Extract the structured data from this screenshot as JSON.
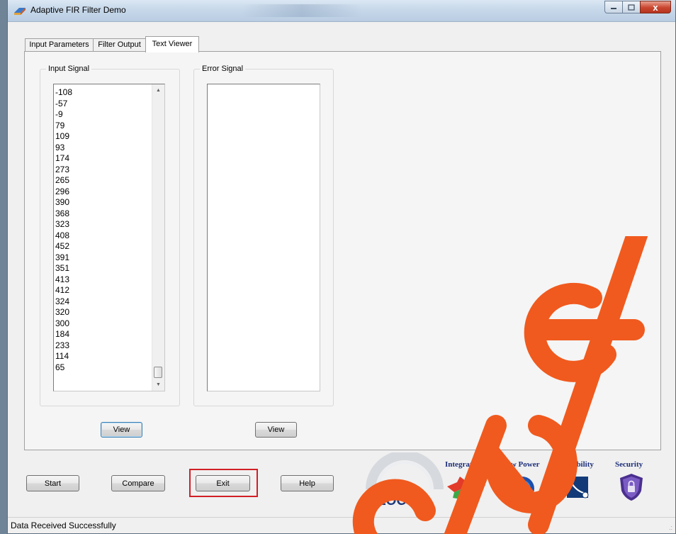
{
  "window": {
    "title": "Adaptive FIR Filter Demo",
    "minimize_icon": "minimize-icon",
    "maximize_icon": "maximize-icon",
    "close_glyph": "x"
  },
  "tabs": [
    {
      "label": "Input Parameters",
      "active": false
    },
    {
      "label": "Filter Output",
      "active": false
    },
    {
      "label": "Text Viewer",
      "active": true
    }
  ],
  "input_signal": {
    "label": "Input Signal",
    "values": [
      "-108",
      "-57",
      "-9",
      "79",
      "109",
      "93",
      "174",
      "273",
      "265",
      "296",
      "390",
      "368",
      "323",
      "408",
      "452",
      "391",
      "351",
      "413",
      "412",
      "324",
      "320",
      "300",
      "184",
      "233",
      "114",
      "65"
    ],
    "view_label": "View"
  },
  "error_signal": {
    "label": "Error Signal",
    "values": [],
    "view_label": "View"
  },
  "controls": {
    "start_label": "Start",
    "compare_label": "Compare",
    "exit_label": "Exit",
    "help_label": "Help"
  },
  "branding": {
    "logo_text": "IGLOO",
    "logo_suffix": "2",
    "features": [
      {
        "label": "Integration",
        "icon": "puzzle-icon"
      },
      {
        "label": "Low Power",
        "icon": "power-icon"
      },
      {
        "label": "Reliability",
        "icon": "reliability-icon"
      },
      {
        "label": "Security",
        "icon": "shield-icon"
      }
    ],
    "colors": {
      "brand_blue": "#1d2f7a",
      "highlight_red": "#d21f26",
      "watermark": "#f05a1e"
    }
  },
  "status": {
    "text": "Data Received Successfully"
  }
}
